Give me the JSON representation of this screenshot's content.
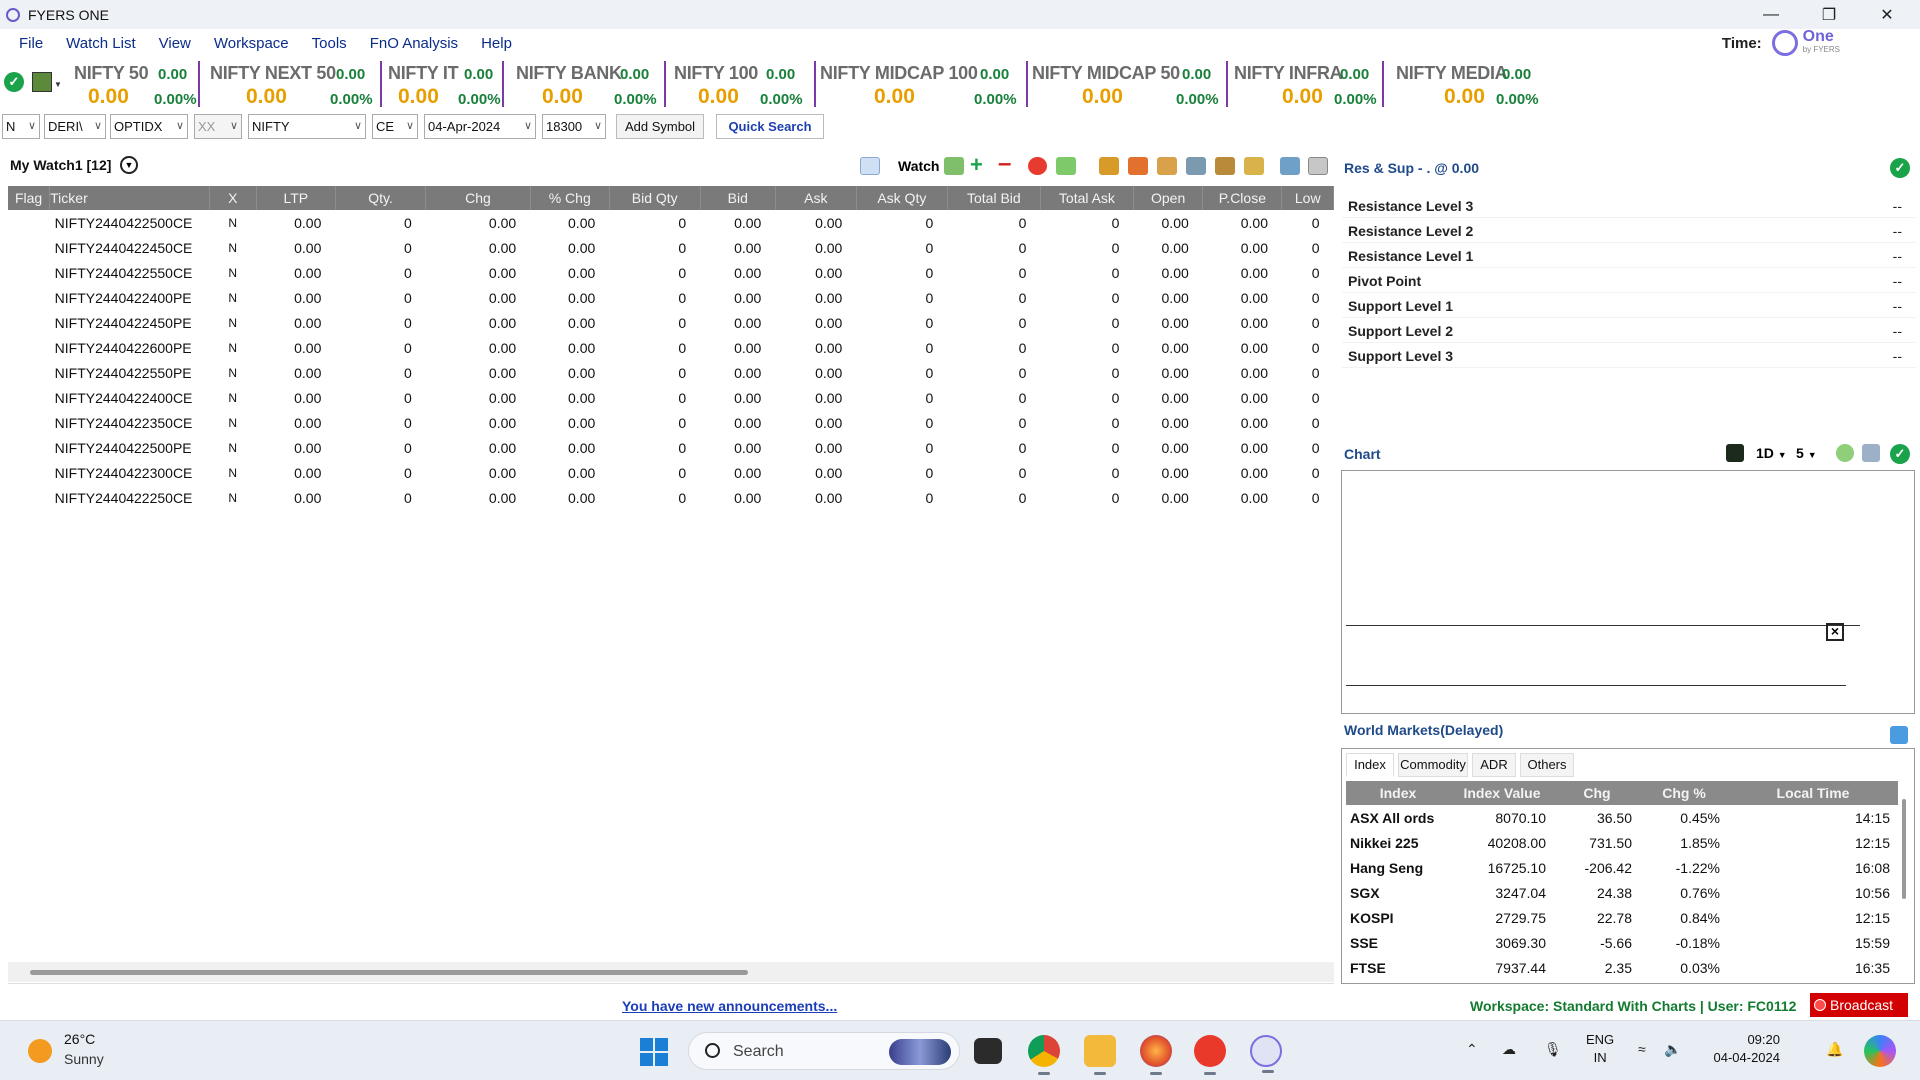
{
  "window": {
    "title": "FYERS ONE"
  },
  "menu": [
    "File",
    "Watch List",
    "View",
    "Workspace",
    "Tools",
    "FnO Analysis",
    "Help"
  ],
  "time_label": "Time:",
  "brand": {
    "name": "One",
    "sub": "by FYERS"
  },
  "indices": [
    {
      "name": "NIFTY 50",
      "chg": "0.00",
      "ltp": "0.00",
      "pct": "0.00%"
    },
    {
      "name": "NIFTY NEXT 50",
      "chg": "0.00",
      "ltp": "0.00",
      "pct": "0.00%"
    },
    {
      "name": "NIFTY IT",
      "chg": "0.00",
      "ltp": "0.00",
      "pct": "0.00%"
    },
    {
      "name": "NIFTY BANK",
      "chg": "0.00",
      "ltp": "0.00",
      "pct": "0.00%"
    },
    {
      "name": "NIFTY 100",
      "chg": "0.00",
      "ltp": "0.00",
      "pct": "0.00%"
    },
    {
      "name": "NIFTY MIDCAP 100",
      "chg": "0.00",
      "ltp": "0.00",
      "pct": "0.00%"
    },
    {
      "name": "NIFTY MIDCAP 50",
      "chg": "0.00",
      "ltp": "0.00",
      "pct": "0.00%"
    },
    {
      "name": "NIFTY INFRA",
      "chg": "0.00",
      "ltp": "0.00",
      "pct": "0.00%"
    },
    {
      "name": "NIFTY MEDIA",
      "chg": "0.00",
      "ltp": "0.00",
      "pct": "0.00%"
    }
  ],
  "symbol_bar": {
    "exchange": "N",
    "segment": "DERI\\",
    "instrument": "OPTIDX",
    "series": "XX",
    "symbol": "NIFTY",
    "option_type": "CE",
    "expiry": "04-Apr-2024",
    "strike": "18300",
    "add_symbol": "Add Symbol",
    "quick_search": "Quick Search"
  },
  "watchlist": {
    "title": "My Watch1 [12]",
    "watch_label": "Watch",
    "columns": [
      "Flag",
      "Ticker",
      "X",
      "LTP",
      "Qty.",
      "Chg",
      "% Chg",
      "Bid Qty",
      "Bid",
      "Ask",
      "Ask Qty",
      "Total Bid",
      "Total Ask",
      "Open",
      "P.Close",
      "Low"
    ],
    "rows": [
      [
        "",
        "NIFTY2440422500CE",
        "N",
        "0.00",
        "0",
        "0.00",
        "0.00",
        "0",
        "0.00",
        "0.00",
        "0",
        "0",
        "0",
        "0.00",
        "0.00",
        "0"
      ],
      [
        "",
        "NIFTY2440422450CE",
        "N",
        "0.00",
        "0",
        "0.00",
        "0.00",
        "0",
        "0.00",
        "0.00",
        "0",
        "0",
        "0",
        "0.00",
        "0.00",
        "0"
      ],
      [
        "",
        "NIFTY2440422550CE",
        "N",
        "0.00",
        "0",
        "0.00",
        "0.00",
        "0",
        "0.00",
        "0.00",
        "0",
        "0",
        "0",
        "0.00",
        "0.00",
        "0"
      ],
      [
        "",
        "NIFTY2440422400PE",
        "N",
        "0.00",
        "0",
        "0.00",
        "0.00",
        "0",
        "0.00",
        "0.00",
        "0",
        "0",
        "0",
        "0.00",
        "0.00",
        "0"
      ],
      [
        "",
        "NIFTY2440422450PE",
        "N",
        "0.00",
        "0",
        "0.00",
        "0.00",
        "0",
        "0.00",
        "0.00",
        "0",
        "0",
        "0",
        "0.00",
        "0.00",
        "0"
      ],
      [
        "",
        "NIFTY2440422600PE",
        "N",
        "0.00",
        "0",
        "0.00",
        "0.00",
        "0",
        "0.00",
        "0.00",
        "0",
        "0",
        "0",
        "0.00",
        "0.00",
        "0"
      ],
      [
        "",
        "NIFTY2440422550PE",
        "N",
        "0.00",
        "0",
        "0.00",
        "0.00",
        "0",
        "0.00",
        "0.00",
        "0",
        "0",
        "0",
        "0.00",
        "0.00",
        "0"
      ],
      [
        "",
        "NIFTY2440422400CE",
        "N",
        "0.00",
        "0",
        "0.00",
        "0.00",
        "0",
        "0.00",
        "0.00",
        "0",
        "0",
        "0",
        "0.00",
        "0.00",
        "0"
      ],
      [
        "",
        "NIFTY2440422350CE",
        "N",
        "0.00",
        "0",
        "0.00",
        "0.00",
        "0",
        "0.00",
        "0.00",
        "0",
        "0",
        "0",
        "0.00",
        "0.00",
        "0"
      ],
      [
        "",
        "NIFTY2440422500PE",
        "N",
        "0.00",
        "0",
        "0.00",
        "0.00",
        "0",
        "0.00",
        "0.00",
        "0",
        "0",
        "0",
        "0.00",
        "0.00",
        "0"
      ],
      [
        "",
        "NIFTY2440422300CE",
        "N",
        "0.00",
        "0",
        "0.00",
        "0.00",
        "0",
        "0.00",
        "0.00",
        "0",
        "0",
        "0",
        "0.00",
        "0.00",
        "0"
      ],
      [
        "",
        "NIFTY2440422250CE",
        "N",
        "0.00",
        "0",
        "0.00",
        "0.00",
        "0",
        "0.00",
        "0.00",
        "0",
        "0",
        "0",
        "0.00",
        "0.00",
        "0"
      ]
    ]
  },
  "res_sup": {
    "title": "Res & Sup - . @ 0.00",
    "levels": [
      {
        "label": "Resistance Level 3",
        "value": "--"
      },
      {
        "label": "Resistance Level 2",
        "value": "--"
      },
      {
        "label": "Resistance Level 1",
        "value": "--"
      },
      {
        "label": "Pivot Point",
        "value": "--"
      },
      {
        "label": "Support Level 1",
        "value": "--"
      },
      {
        "label": "Support Level 2",
        "value": "--"
      },
      {
        "label": "Support Level 3",
        "value": "--"
      }
    ]
  },
  "chart_panel": {
    "title": "Chart",
    "interval": "1D",
    "count": "5"
  },
  "world_markets": {
    "title": "World Markets(Delayed)",
    "tabs": [
      "Index",
      "Commodity",
      "ADR",
      "Others"
    ],
    "active_tab": "Index",
    "columns": [
      "Index",
      "Index Value",
      "Chg",
      "Chg %",
      "Local Time"
    ],
    "rows": [
      {
        "name": "ASX All ords",
        "value": "8070.10",
        "chg": "36.50",
        "pct": "0.45%",
        "time": "14:15",
        "dir": "pos"
      },
      {
        "name": "Nikkei 225",
        "value": "40208.00",
        "chg": "731.50",
        "pct": "1.85%",
        "time": "12:15",
        "dir": "pos"
      },
      {
        "name": "Hang Seng",
        "value": "16725.10",
        "chg": "-206.42",
        "pct": "-1.22%",
        "time": "16:08",
        "dir": "neg"
      },
      {
        "name": "SGX",
        "value": "3247.04",
        "chg": "24.38",
        "pct": "0.76%",
        "time": "10:56",
        "dir": "pos"
      },
      {
        "name": "KOSPI",
        "value": "2729.75",
        "chg": "22.78",
        "pct": "0.84%",
        "time": "12:15",
        "dir": "pos"
      },
      {
        "name": "SSE",
        "value": "3069.30",
        "chg": "-5.66",
        "pct": "-0.18%",
        "time": "15:59",
        "dir": "neg"
      },
      {
        "name": "FTSE",
        "value": "7937.44",
        "chg": "2.35",
        "pct": "0.03%",
        "time": "16:35",
        "dir": "pos"
      }
    ]
  },
  "status": {
    "announcement": "You have new announcements...",
    "workspace": "Workspace: Standard With Charts | User: FC0112",
    "broadcast": "Broadcast"
  },
  "taskbar": {
    "weather_temp": "26°C",
    "weather_cond": "Sunny",
    "search_placeholder": "Search",
    "lang_top": "ENG",
    "lang_bottom": "IN",
    "time": "09:20",
    "date": "04-04-2024"
  },
  "colors": {
    "accent": "#1f4a8a",
    "positive": "#1c8a38",
    "negative": "#d42020",
    "ltp": "#e8a000"
  }
}
